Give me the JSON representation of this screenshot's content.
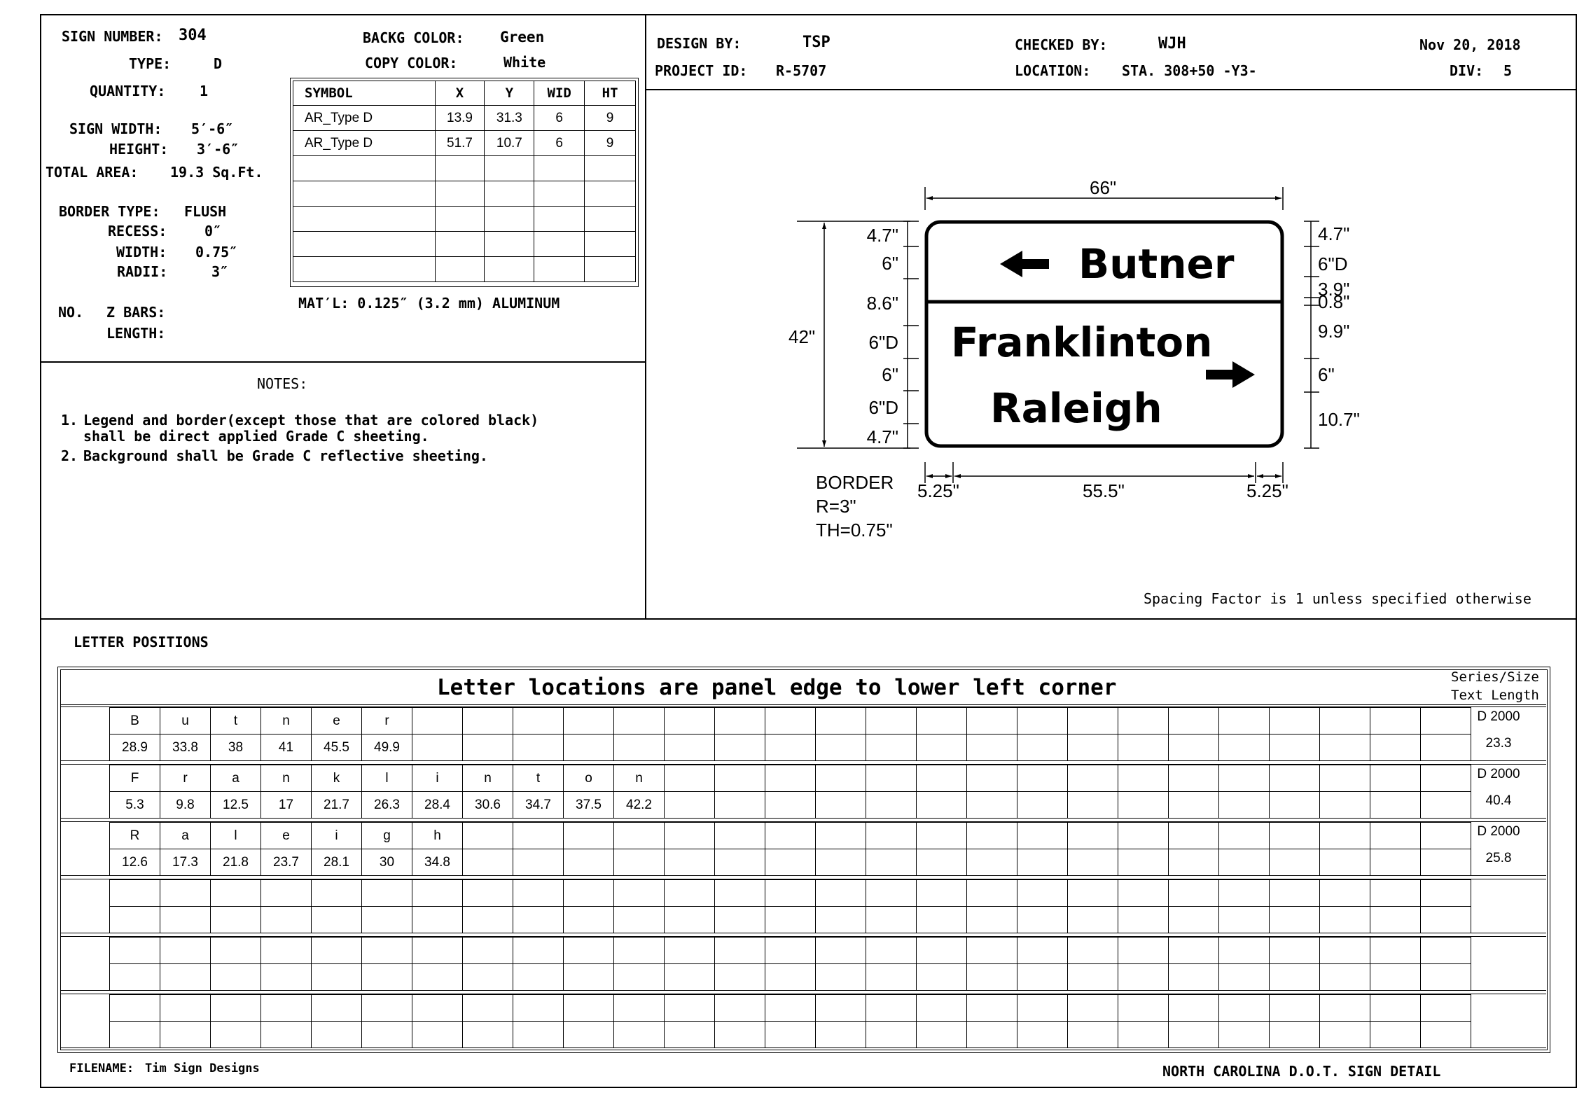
{
  "header": {
    "sign_number_label": "SIGN NUMBER:",
    "sign_number": "304",
    "type_label": "TYPE:",
    "type": "D",
    "quantity_label": "QUANTITY:",
    "quantity": "1",
    "sign_width_label": "SIGN WIDTH:",
    "sign_width": "5′-6″",
    "height_label": "HEIGHT:",
    "height": "3′-6″",
    "total_area_label": "TOTAL AREA:",
    "total_area": "19.3 Sq.Ft.",
    "border_type_label": "BORDER TYPE:",
    "border_type": "FLUSH",
    "recess_label": "RECESS:",
    "recess": "0″",
    "width_label": "WIDTH:",
    "width": "0.75″",
    "radii_label": "RADII:",
    "radii": "3″",
    "no_label": "NO.",
    "zbars_label": "Z BARS:",
    "length_label": "LENGTH:",
    "backg_color_label": "BACKG COLOR:",
    "backg_color": "Green",
    "copy_color_label": "COPY COLOR:",
    "copy_color": "White",
    "material": "MAT′L: 0.125″ (3.2 mm) ALUMINUM",
    "design_by_label": "DESIGN BY:",
    "design_by": "TSP",
    "project_id_label": "PROJECT ID:",
    "project_id": "R-5707",
    "checked_by_label": "CHECKED BY:",
    "checked_by": "WJH",
    "location_label": "LOCATION:",
    "location": "STA. 308+50 -Y3-",
    "date": "Nov 20, 2018",
    "div_label": "DIV:",
    "div": "5"
  },
  "symbol_table": {
    "columns": [
      "SYMBOL",
      "X",
      "Y",
      "WID",
      "HT"
    ],
    "rows": [
      [
        "AR_Type D",
        "13.9",
        "31.3",
        "6",
        "9"
      ],
      [
        "AR_Type D",
        "51.7",
        "10.7",
        "6",
        "9"
      ],
      [
        "",
        "",
        "",
        "",
        ""
      ],
      [
        "",
        "",
        "",
        "",
        ""
      ],
      [
        "",
        "",
        "",
        "",
        ""
      ],
      [
        "",
        "",
        "",
        "",
        ""
      ],
      [
        "",
        "",
        "",
        "",
        ""
      ]
    ]
  },
  "notes": {
    "title": "NOTES:",
    "items": [
      {
        "num": "1.",
        "line1": "Legend and border(except those that are colored black)",
        "line2": "shall be direct applied Grade C sheeting."
      },
      {
        "num": "2.",
        "line1": "Background shall be Grade C reflective sheeting.",
        "line2": ""
      }
    ]
  },
  "sign": {
    "top_text": "Butner",
    "line1": "Franklinton",
    "line2": "Raleigh",
    "dims": {
      "width": "66\"",
      "height": "42\"",
      "left": [
        "4.7\"",
        "6\"",
        "8.6\"",
        "6\"D",
        "6\"",
        "6\"D",
        "4.7\""
      ],
      "right": [
        "4.7\"",
        "6\"D",
        "3.9\"",
        "0.8\"",
        "9.9\"",
        "6\"",
        "10.7\""
      ],
      "bottom_left": "5.25\"",
      "bottom_mid": "55.5\"",
      "bottom_right": "5.25\""
    },
    "border_note": [
      "BORDER",
      "R=3\"",
      "TH=0.75\""
    ],
    "spacing_note": "Spacing Factor is 1 unless specified otherwise"
  },
  "letters": {
    "section_title": "LETTER POSITIONS",
    "banner": "Letter locations are panel edge to lower left corner",
    "series_header": "Series/Size",
    "length_header": "Text Length",
    "rows": [
      {
        "letters": [
          "B",
          "u",
          "t",
          "n",
          "e",
          "r"
        ],
        "positions": [
          "28.9",
          "33.8",
          "38",
          "41",
          "45.5",
          "49.9"
        ],
        "series": "D 2000",
        "length": "23.3"
      },
      {
        "letters": [
          "F",
          "r",
          "a",
          "n",
          "k",
          "l",
          "i",
          "n",
          "t",
          "o",
          "n"
        ],
        "positions": [
          "5.3",
          "9.8",
          "12.5",
          "17",
          "21.7",
          "26.3",
          "28.4",
          "30.6",
          "34.7",
          "37.5",
          "42.2"
        ],
        "series": "D 2000",
        "length": "40.4"
      },
      {
        "letters": [
          "R",
          "a",
          "l",
          "e",
          "i",
          "g",
          "h"
        ],
        "positions": [
          "12.6",
          "17.3",
          "21.8",
          "23.7",
          "28.1",
          "30",
          "34.8"
        ],
        "series": "D 2000",
        "length": "25.8"
      },
      {
        "letters": [],
        "positions": [],
        "series": "",
        "length": ""
      },
      {
        "letters": [],
        "positions": [],
        "series": "",
        "length": ""
      },
      {
        "letters": [],
        "positions": [],
        "series": "",
        "length": ""
      }
    ]
  },
  "footer": {
    "filename_label": "FILENAME:",
    "filename": "Tim Sign Designs",
    "title": "NORTH CAROLINA D.O.T. SIGN DETAIL"
  }
}
